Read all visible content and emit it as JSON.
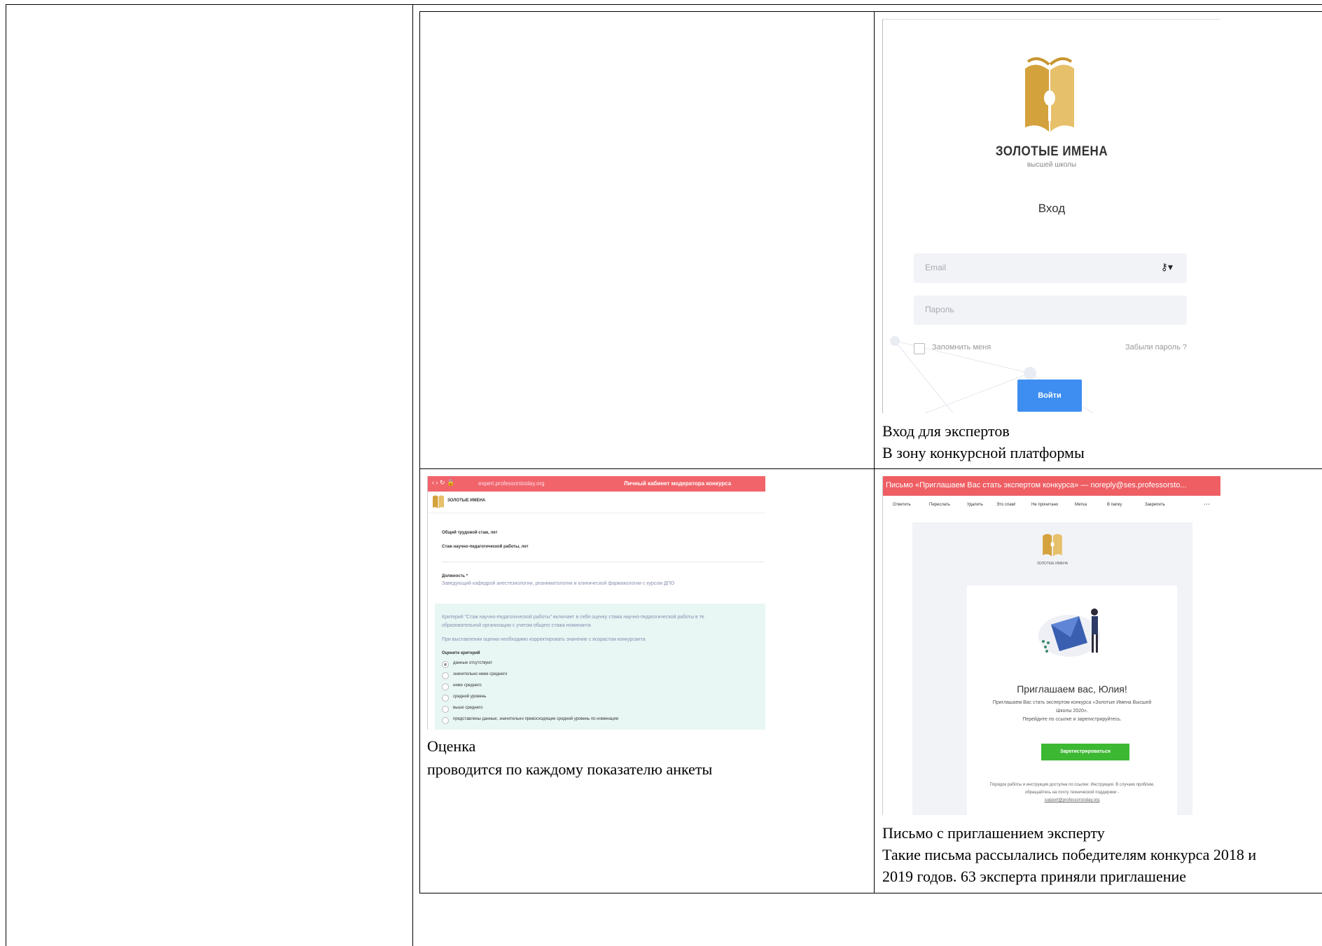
{
  "cell_top_right": {
    "caption_line1": "Вход для экспертов",
    "caption_line2": "В зону конкурсной платформы",
    "login": {
      "logo_title": "ЗОЛОТЫЕ ИМЕНА",
      "logo_subtitle": "высшей школы",
      "heading": "Вход",
      "email_placeholder": "Email",
      "password_placeholder": "Пароль",
      "remember_label": "Запомнить меня",
      "forgot_link": "Забыли пароль ?",
      "submit_label": "Войти",
      "accent": "#3d8ef0"
    }
  },
  "cell_bottom_left": {
    "caption_line1": "Оценка",
    "caption_line2": "проводится по каждому показателю анкеты",
    "form": {
      "url": "expert.professorstoday.org",
      "header_title": "Личный кабинет модератора конкурса",
      "logo_text": "ЗОЛОТЫЕ ИМЕНА",
      "field1": "Общий трудовой стаж, лет",
      "field2": "Стаж научно-педагогической работы, лет",
      "field3_label": "Должность *",
      "field3_value": "Заведующий кафедрой анестезиологии, реаниматологии и клинической фармакологии с курсом ДПО",
      "note1": "Критерий \"Стаж научно-педагогической работы\" включает в себя оценку стажа научно-педагогической работы в те",
      "note1b": "образовательной организации с учетом общего стажа номинанта",
      "note2": "При выставлении оценки необходимо корректировать значение с возрастом конкурсанта",
      "rate_label": "Оцените критерий",
      "options": [
        "данные отсутствуют",
        "значительно ниже среднего",
        "ниже среднего",
        "средний уровень",
        "выше среднего",
        "представлены данные, значительно превосходящие средний уровень по номинации"
      ],
      "accent": "#f0646a"
    }
  },
  "cell_bottom_right": {
    "caption_line1": "Письмо с приглашением эксперту",
    "caption_line2": "Такие письма рассылались победителям конкурса 2018 и",
    "caption_line3": "2019 годов. 63 эксперта приняли приглашение",
    "email": {
      "titlebar": "Письмо «Приглашаем Вас стать экспертом конкурса» — noreply@ses.professorsto...",
      "toolbar": [
        "Ответить",
        "Переслать",
        "Удалить",
        "Это спам!",
        "Не прочитано",
        "Метка",
        "В папку",
        "Закрепить"
      ],
      "logo_text": "ЗОЛОТЫЕ ИМЕНА",
      "greeting": "Приглашаем вас, Юлия!",
      "body1": "Приглашаем Вас стать экспертом конкурса «Золотые Имена Высшей Школы 2020».",
      "body2": "Перейдите по ссылке и зарегистрируйтесь.",
      "register_button": "Зарегистрироваться",
      "footer1": "Порядок работы и инструкция доступна по ссылке: Инструкция. В случаях проблем, обращайтесь на почту технической поддержки -",
      "footer_link": "support@professorstoday.org",
      "titlebar_color": "#ee5e63",
      "button_color": "#3cb832"
    }
  }
}
